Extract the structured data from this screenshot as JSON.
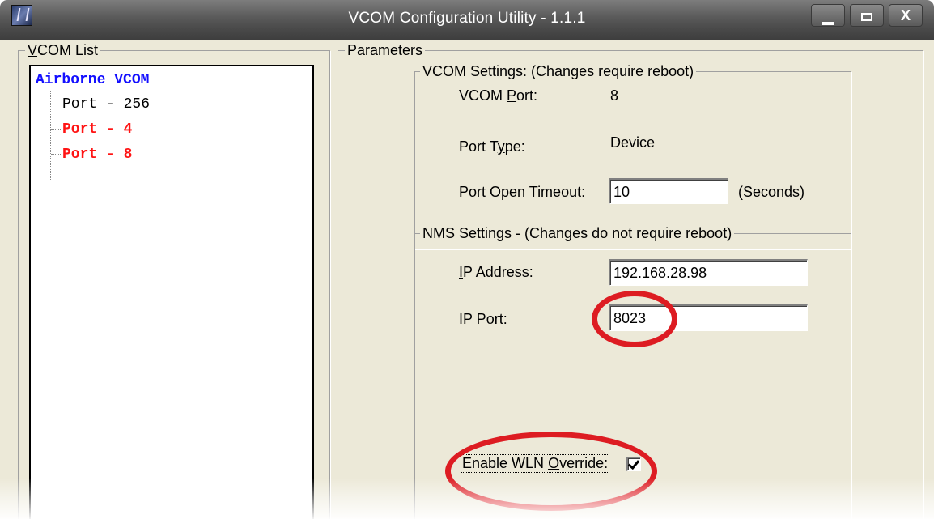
{
  "window": {
    "title": "VCOM Configuration Utility - 1.1.1",
    "controls": {
      "minimize": "minimize",
      "maximize": "maximize",
      "close": "X"
    }
  },
  "vcom_list": {
    "legend": "VCOM List",
    "root": "Airborne VCOM",
    "items": [
      {
        "label": "Port - 256",
        "highlighted": false
      },
      {
        "label": "Port - 4",
        "highlighted": true
      },
      {
        "label": "Port - 8",
        "highlighted": true
      }
    ]
  },
  "parameters": {
    "legend": "Parameters",
    "vcom_settings": {
      "legend": "VCOM Settings: (Changes require reboot)",
      "vcom_port_label": "VCOM Port:",
      "vcom_port_value": "8",
      "port_type_label": "Port Type:",
      "port_type_value": "Device",
      "timeout_label": "Port Open Timeout:",
      "timeout_value": "10",
      "timeout_unit": "(Seconds)"
    },
    "nms_settings": {
      "legend": "NMS Settings - (Changes do not require reboot)",
      "ip_address_label": "IP Address:",
      "ip_address_value": "192.168.28.98",
      "ip_port_label": "IP Port:",
      "ip_port_value": "8023",
      "wln_override_label": "Enable WLN Override:",
      "wln_override_checked": true
    }
  },
  "colors": {
    "tree_root": "#1410ff",
    "tree_highlight": "#ff1414",
    "annotation_ring": "#dd1c22",
    "dialog_face": "#ece9d8"
  }
}
